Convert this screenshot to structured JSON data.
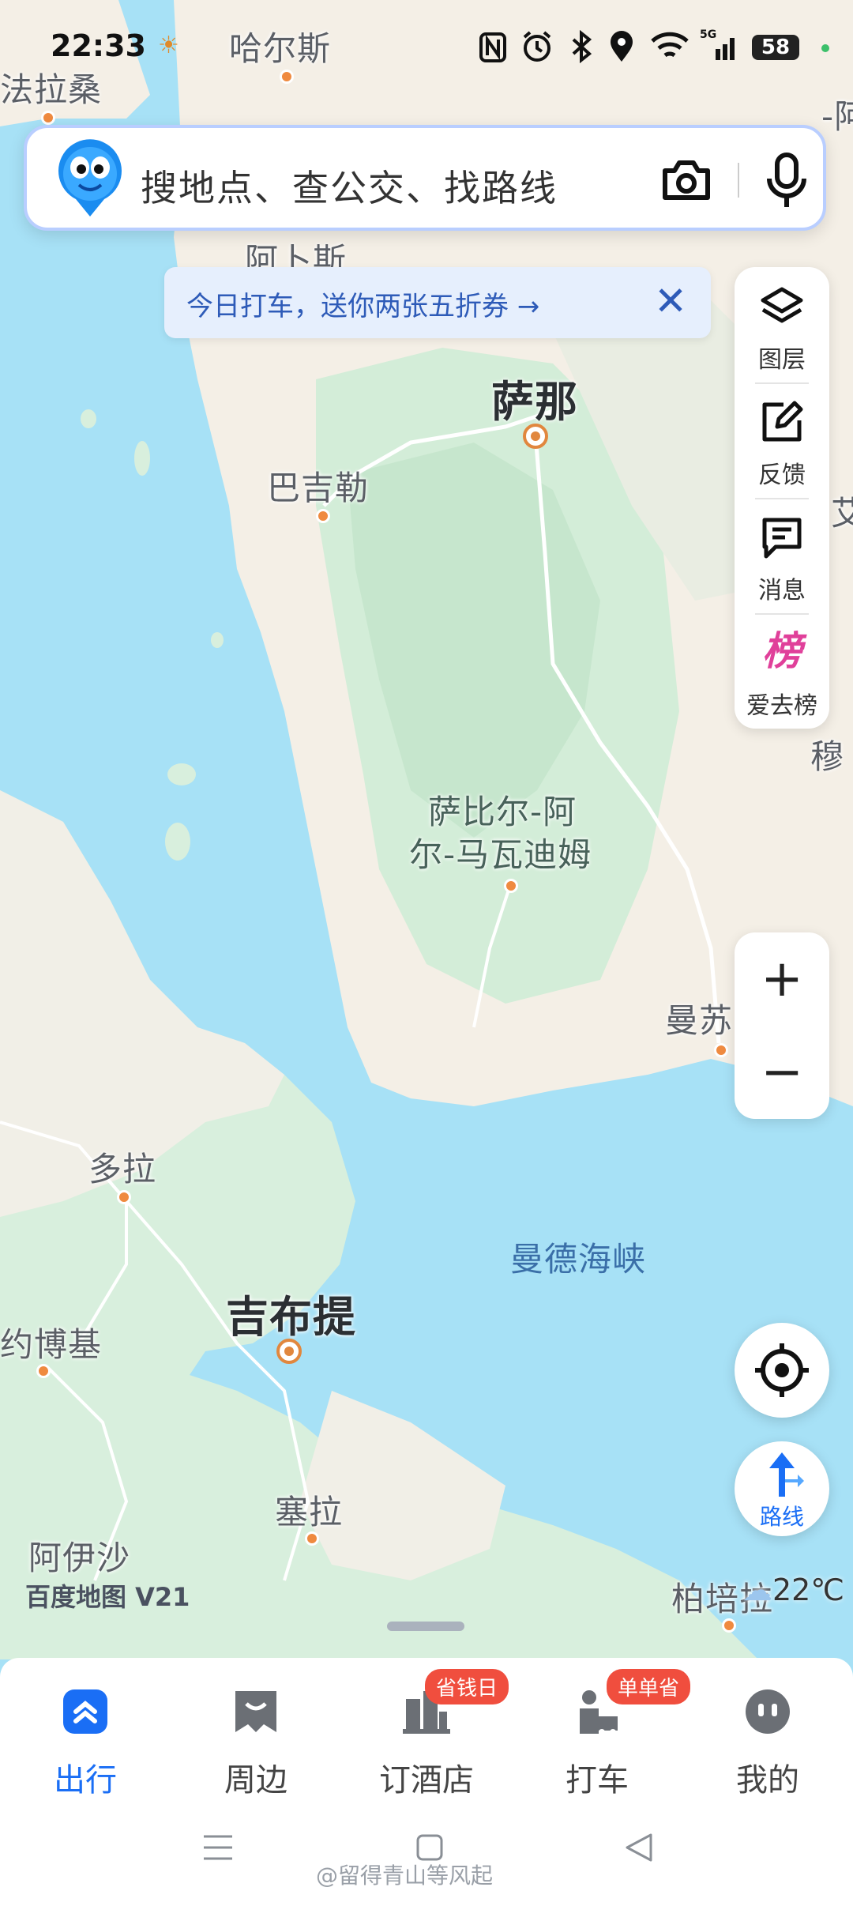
{
  "status_bar": {
    "time": "22:33",
    "icons": [
      "nfc-icon",
      "alarm-icon",
      "bluetooth-icon",
      "location-icon",
      "wifi-icon",
      "signal-5g-icon"
    ],
    "battery": "58"
  },
  "search": {
    "placeholder": "搜地点、查公交、找路线"
  },
  "banner": {
    "text": "今日打车，送你两张五折券 →",
    "close": "✕"
  },
  "tools": [
    {
      "label": "图层",
      "icon": "layers-icon"
    },
    {
      "label": "反馈",
      "icon": "feedback-icon"
    },
    {
      "label": "消息",
      "icon": "message-icon"
    },
    {
      "label": "爱去榜",
      "icon": "ranking-icon"
    }
  ],
  "zoom": {
    "in": "+",
    "out": "−"
  },
  "route_button": {
    "label": "路线"
  },
  "map": {
    "logo": "百度地图 V21",
    "weather": "22℃",
    "places": {
      "harsi": "哈尔斯",
      "falasang": "法拉桑",
      "abus": "阿卜斯",
      "sana": "萨那",
      "bajile": "巴吉勒",
      "sabier": "萨比尔-阿",
      "sabier2": "尔-马瓦迪姆",
      "mansu": "曼苏",
      "mandesea": "曼德海峡",
      "duola": "多拉",
      "djibouti": "吉布提",
      "yuebo": "约博基",
      "saila": "塞拉",
      "ayisha": "阿伊沙",
      "bobeila": "柏培拉",
      "mu": "穆",
      "edge_a": "-阿",
      "edge_b": "艾"
    }
  },
  "nav": [
    {
      "label": "出行",
      "active": true,
      "icon": "travel-icon"
    },
    {
      "label": "周边",
      "active": false,
      "icon": "nearby-icon"
    },
    {
      "label": "订酒店",
      "active": false,
      "icon": "hotel-icon",
      "badge": "省钱日"
    },
    {
      "label": "打车",
      "active": false,
      "icon": "taxi-icon",
      "badge": "单单省"
    },
    {
      "label": "我的",
      "active": false,
      "icon": "profile-icon"
    }
  ],
  "watermark": "@留得青山等风起"
}
